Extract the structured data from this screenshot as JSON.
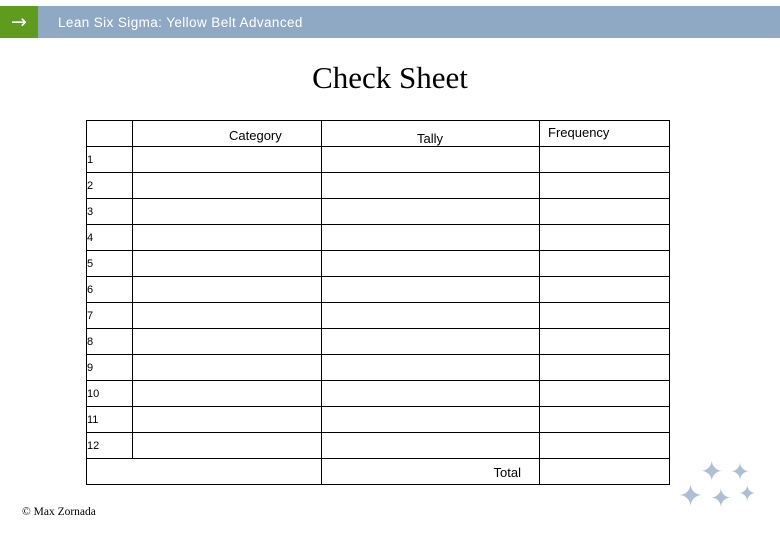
{
  "header": {
    "logo_icon": "arrow-right-icon",
    "logo_glyph": "→",
    "title": "Lean Six Sigma: Yellow Belt Advanced",
    "bar_color": "#8fa9c4",
    "logo_color": "#5f9c1e"
  },
  "page": {
    "title": "Check Sheet"
  },
  "table": {
    "headers": {
      "category": "Category",
      "tally": "Tally",
      "frequency": "Frequency"
    },
    "row_numbers": [
      "1",
      "2",
      "3",
      "4",
      "5",
      "6",
      "7",
      "8",
      "9",
      "10",
      "11",
      "12"
    ],
    "rows": [
      {
        "number": "1",
        "category": "",
        "tally": "",
        "frequency": ""
      },
      {
        "number": "2",
        "category": "",
        "tally": "",
        "frequency": ""
      },
      {
        "number": "3",
        "category": "",
        "tally": "",
        "frequency": ""
      },
      {
        "number": "4",
        "category": "",
        "tally": "",
        "frequency": ""
      },
      {
        "number": "5",
        "category": "",
        "tally": "",
        "frequency": ""
      },
      {
        "number": "6",
        "category": "",
        "tally": "",
        "frequency": ""
      },
      {
        "number": "7",
        "category": "",
        "tally": "",
        "frequency": ""
      },
      {
        "number": "8",
        "category": "",
        "tally": "",
        "frequency": ""
      },
      {
        "number": "9",
        "category": "",
        "tally": "",
        "frequency": ""
      },
      {
        "number": "10",
        "category": "",
        "tally": "",
        "frequency": ""
      },
      {
        "number": "11",
        "category": "",
        "tally": "",
        "frequency": ""
      },
      {
        "number": "12",
        "category": "",
        "tally": "",
        "frequency": ""
      }
    ],
    "total_label": "Total",
    "total_value": ""
  },
  "footer": {
    "copyright": "© Max Zornada"
  },
  "decoration": {
    "star_glyph": "✦",
    "star_color": "#aebfd4",
    "star_count": 5
  }
}
